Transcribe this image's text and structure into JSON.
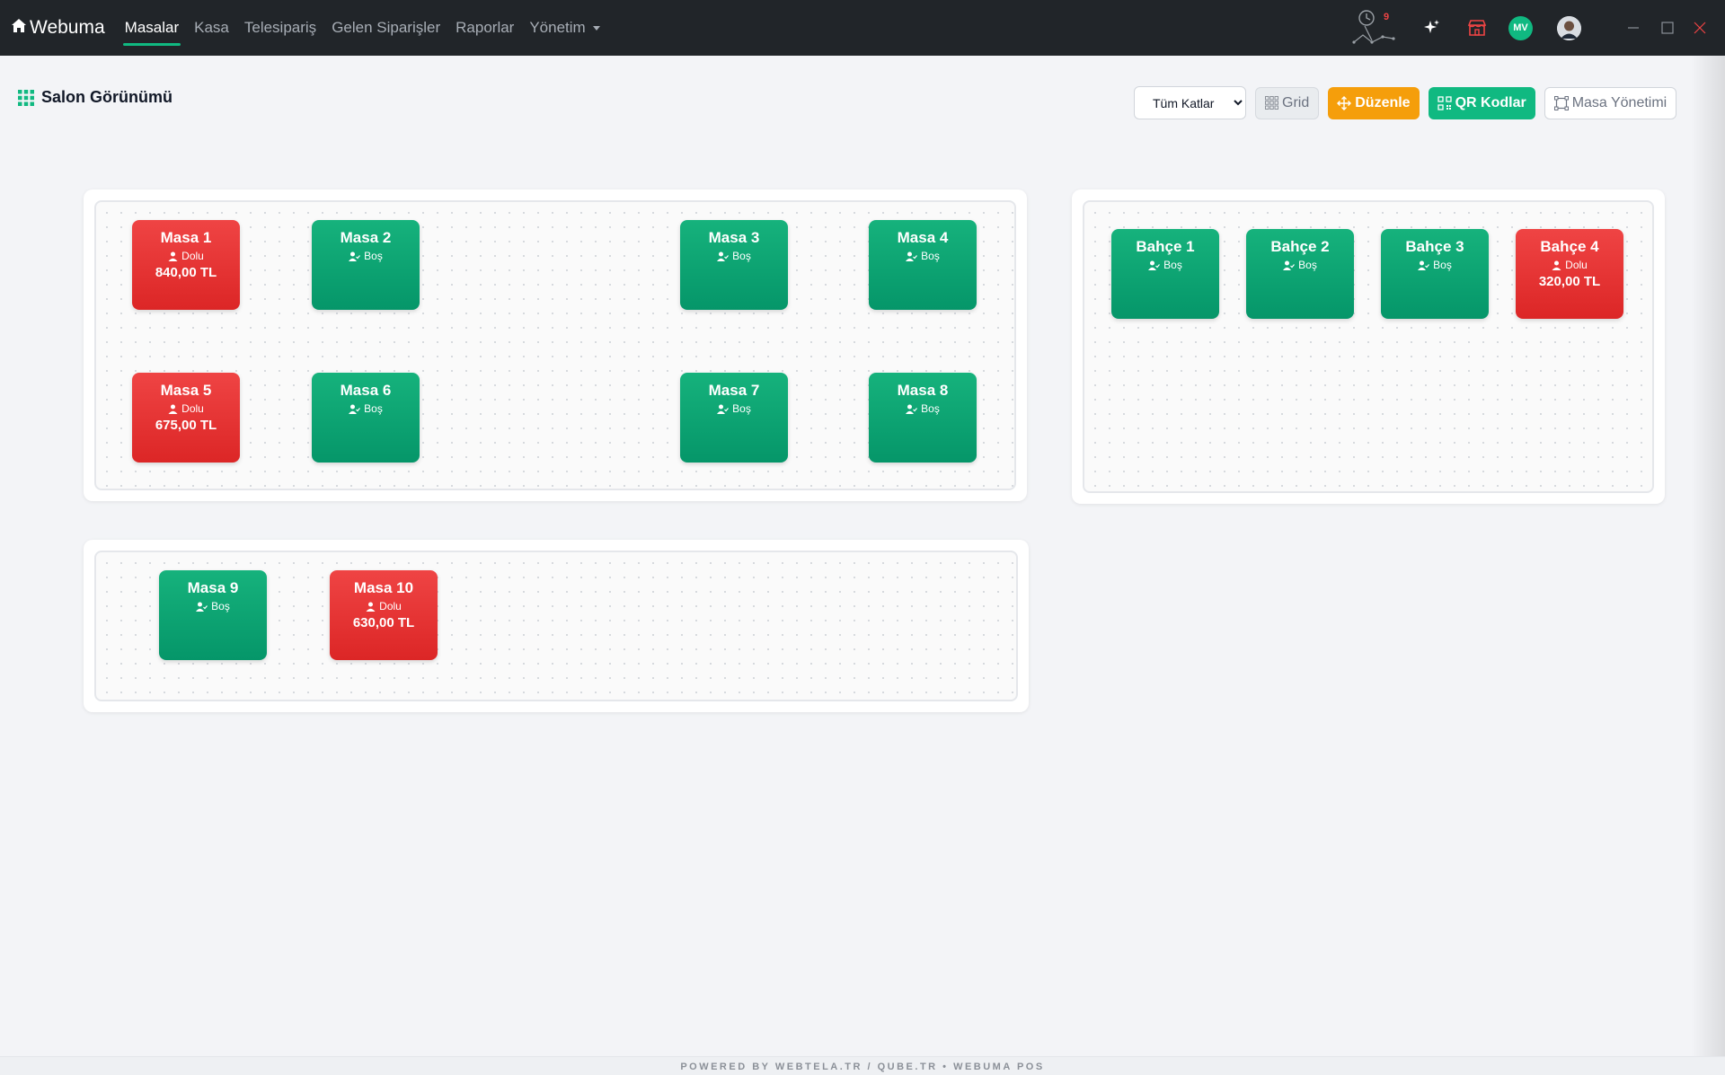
{
  "brand": {
    "name": "Webuma"
  },
  "nav": {
    "items": [
      {
        "label": "Masalar",
        "active": true
      },
      {
        "label": "Kasa"
      },
      {
        "label": "Telesipariş"
      },
      {
        "label": "Gelen Siparişler"
      },
      {
        "label": "Raporlar"
      },
      {
        "label": "Yönetim",
        "dropdown": true
      }
    ],
    "notification_count": "9",
    "user_initials": "MV"
  },
  "page": {
    "title": "Salon Görünümü"
  },
  "toolbar": {
    "floor_select": {
      "selected": "Tüm Katlar",
      "options": [
        "Tüm Katlar"
      ]
    },
    "grid_label": "Grid",
    "edit_label": "Düzenle",
    "qr_label": "QR Kodlar",
    "manage_label": "Masa Yönetimi"
  },
  "zones": [
    {
      "tables": [
        {
          "name": "Masa 1",
          "status": "Dolu",
          "amount": "840,00 TL",
          "busy": true
        },
        {
          "name": "Masa 2",
          "status": "Boş",
          "busy": false
        },
        {
          "name": "Masa 3",
          "status": "Boş",
          "busy": false
        },
        {
          "name": "Masa 4",
          "status": "Boş",
          "busy": false
        },
        {
          "name": "Masa 5",
          "status": "Dolu",
          "amount": "675,00 TL",
          "busy": true
        },
        {
          "name": "Masa 6",
          "status": "Boş",
          "busy": false
        },
        {
          "name": "Masa 7",
          "status": "Boş",
          "busy": false
        },
        {
          "name": "Masa 8",
          "status": "Boş",
          "busy": false
        }
      ]
    },
    {
      "tables": [
        {
          "name": "Bahçe 1",
          "status": "Boş",
          "busy": false
        },
        {
          "name": "Bahçe 2",
          "status": "Boş",
          "busy": false
        },
        {
          "name": "Bahçe 3",
          "status": "Boş",
          "busy": false
        },
        {
          "name": "Bahçe 4",
          "status": "Dolu",
          "amount": "320,00 TL",
          "busy": true
        }
      ]
    },
    {
      "tables": [
        {
          "name": "Masa 9",
          "status": "Boş",
          "busy": false
        },
        {
          "name": "Masa 10",
          "status": "Dolu",
          "amount": "630,00 TL",
          "busy": true
        }
      ]
    }
  ],
  "footer": {
    "text": "POWERED BY WEBTELA.TR / QUBE.TR • WEBUMA POS"
  },
  "colors": {
    "free": "#059669",
    "busy": "#dc2626",
    "accent": "#10b981",
    "edit": "#f59e0b"
  }
}
